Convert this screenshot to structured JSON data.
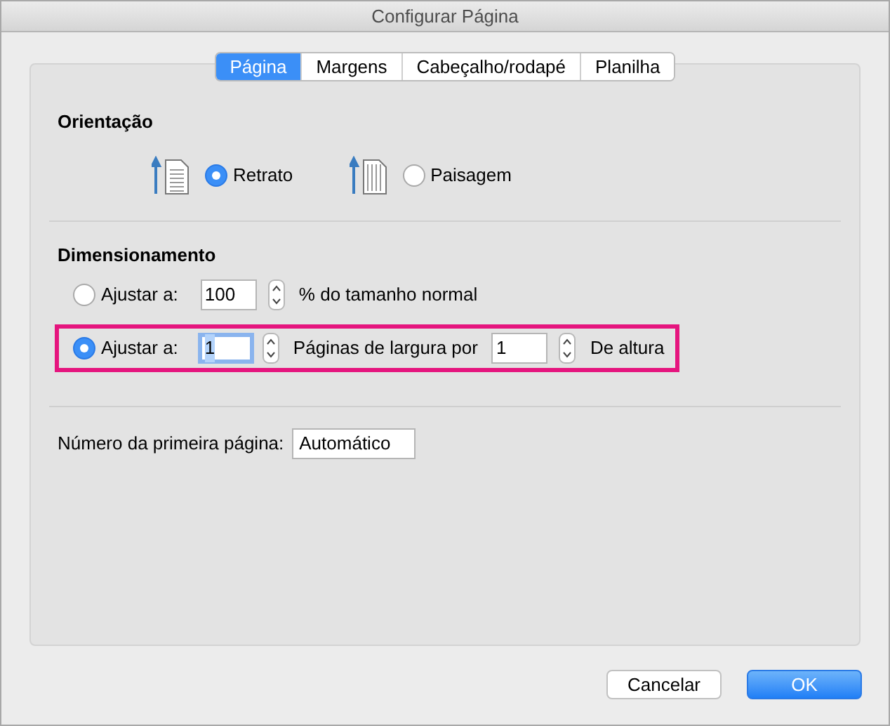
{
  "window": {
    "title": "Configurar Página"
  },
  "tabs": [
    {
      "label": "Página",
      "selected": true
    },
    {
      "label": "Margens",
      "selected": false
    },
    {
      "label": "Cabeçalho/rodapé",
      "selected": false
    },
    {
      "label": "Planilha",
      "selected": false
    }
  ],
  "orientation": {
    "heading": "Orientação",
    "options": [
      {
        "kind": "portrait",
        "label": "Retrato",
        "selected": true
      },
      {
        "kind": "landscape",
        "label": "Paisagem",
        "selected": false
      }
    ]
  },
  "scaling": {
    "heading": "Dimensionamento",
    "rows": [
      {
        "label": "Ajustar a:",
        "selected": false,
        "highlighted": false,
        "parts": [
          {
            "kind": "field",
            "value": "100",
            "focused": false
          },
          {
            "kind": "text",
            "text": "% do tamanho normal"
          }
        ]
      },
      {
        "label": "Ajustar a:",
        "selected": true,
        "highlighted": true,
        "parts": [
          {
            "kind": "field",
            "value": "1",
            "focused": true
          },
          {
            "kind": "text",
            "text": "Páginas de largura por"
          },
          {
            "kind": "field",
            "value": "1",
            "focused": false
          },
          {
            "kind": "text",
            "text": "De altura"
          }
        ]
      }
    ]
  },
  "first_page": {
    "label": "Número da primeira página:",
    "value": "Automático"
  },
  "buttons": [
    {
      "label": "Cancelar",
      "kind": "secondary"
    },
    {
      "label": "OK",
      "kind": "primary"
    }
  ]
}
